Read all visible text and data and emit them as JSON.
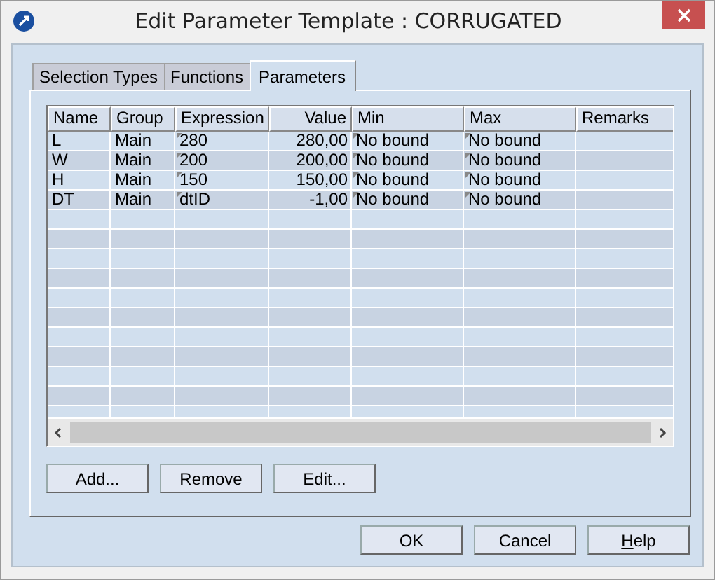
{
  "window": {
    "title": "Edit Parameter Template : CORRUGATED"
  },
  "tabs": [
    {
      "label": "Selection Types",
      "selected": false
    },
    {
      "label": "Functions",
      "selected": false
    },
    {
      "label": "Parameters",
      "selected": true
    }
  ],
  "table": {
    "columns": [
      {
        "label": "Name"
      },
      {
        "label": "Group"
      },
      {
        "label": "Expression"
      },
      {
        "label": "Value"
      },
      {
        "label": "Min"
      },
      {
        "label": "Max"
      },
      {
        "label": "Remarks"
      }
    ],
    "rows": [
      {
        "cells": [
          "L",
          "Main",
          "280",
          "280,00",
          "No bound",
          "No bound",
          ""
        ],
        "marked": [
          false,
          false,
          true,
          false,
          true,
          true,
          false
        ]
      },
      {
        "cells": [
          "W",
          "Main",
          "200",
          "200,00",
          "No bound",
          "No bound",
          ""
        ],
        "marked": [
          false,
          false,
          true,
          false,
          true,
          true,
          false
        ]
      },
      {
        "cells": [
          "H",
          "Main",
          "150",
          "150,00",
          "No bound",
          "No bound",
          ""
        ],
        "marked": [
          false,
          false,
          true,
          false,
          true,
          true,
          false
        ]
      },
      {
        "cells": [
          "DT",
          "Main",
          "dtID",
          "-1,00",
          "No bound",
          "No bound",
          ""
        ],
        "marked": [
          false,
          false,
          true,
          false,
          true,
          true,
          false
        ]
      }
    ]
  },
  "table_buttons": [
    {
      "label": "Add..."
    },
    {
      "label": "Remove"
    },
    {
      "label": "Edit..."
    }
  ],
  "dialog_buttons": [
    {
      "label": "OK",
      "mnemonic": false
    },
    {
      "label": "Cancel",
      "mnemonic": false
    },
    {
      "label": "Help",
      "mnemonic": true
    }
  ]
}
